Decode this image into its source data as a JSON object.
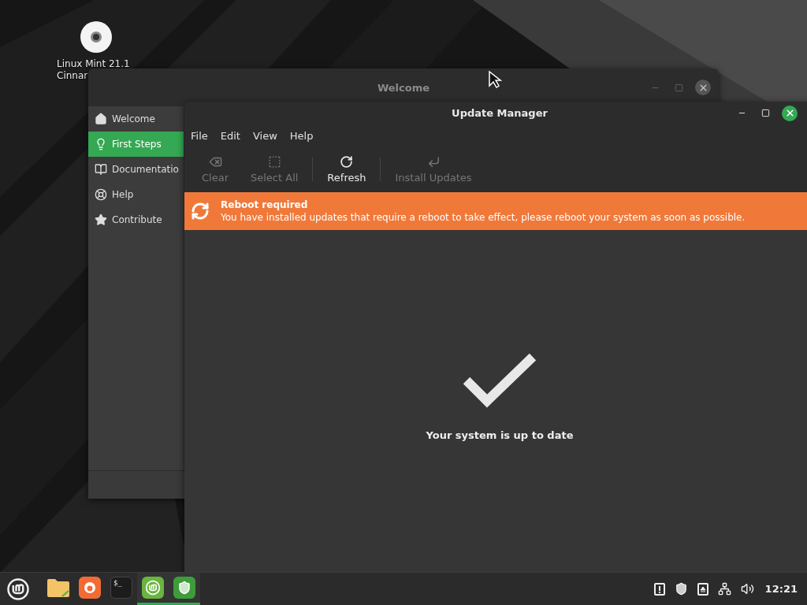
{
  "desktop_icon": {
    "label_lines": [
      "Linux Mint 21.1",
      "Cinnar"
    ]
  },
  "welcome_window": {
    "title": "Welcome",
    "active": false,
    "sidebar": {
      "items": [
        {
          "label": "Welcome",
          "kind": "home",
          "selected": false
        },
        {
          "label": "First Steps",
          "kind": "bulb",
          "selected": true
        },
        {
          "label": "Documentatio",
          "kind": "book",
          "selected": false
        },
        {
          "label": "Help",
          "kind": "help",
          "selected": false
        },
        {
          "label": "Contribute",
          "kind": "star",
          "selected": false
        }
      ]
    }
  },
  "update_window": {
    "title": "Update Manager",
    "active": true,
    "menu": [
      "File",
      "Edit",
      "View",
      "Help"
    ],
    "toolbar": [
      {
        "label": "Clear",
        "kind": "clear",
        "disabled": true
      },
      {
        "label": "Select All",
        "kind": "select",
        "disabled": true
      },
      {
        "label": "Refresh",
        "kind": "refresh",
        "disabled": false
      },
      {
        "label": "Install Updates",
        "kind": "install",
        "disabled": true
      }
    ],
    "banner": {
      "title": "Reboot required",
      "message": "You have installed updates that require a reboot to take effect, please reboot your system as soon as possible."
    },
    "status": "Your system is up to date"
  },
  "taskbar": {
    "launchers": [
      {
        "kind": "folder",
        "running": false
      },
      {
        "kind": "firefox",
        "running": false
      },
      {
        "kind": "terminal",
        "label": "$_",
        "running": false
      },
      {
        "kind": "mint",
        "running": true
      },
      {
        "kind": "shield",
        "running": true
      }
    ],
    "clock": "12:21"
  }
}
